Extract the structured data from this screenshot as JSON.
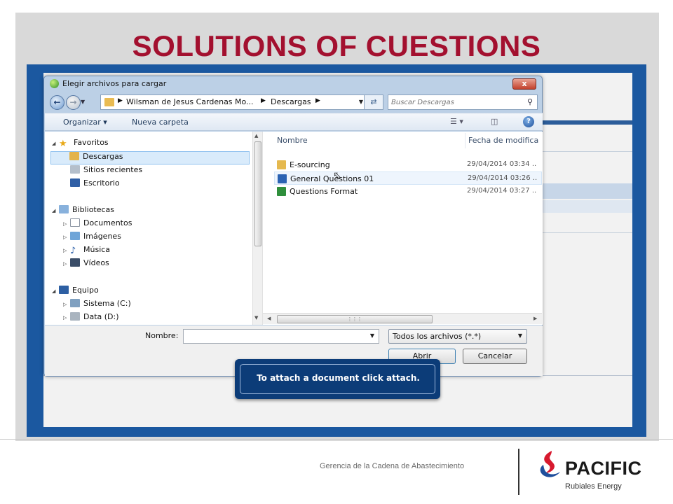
{
  "slide": {
    "title": "SOLUTIONS OF CUESTIONS",
    "title_color": "#a3102f",
    "frame_color": "#1b58a0"
  },
  "dialog": {
    "title": "Elegir archivos para cargar",
    "close_label": "x",
    "back_icon": "back-arrow-icon",
    "forward_icon": "forward-arrow-icon",
    "breadcrumb": [
      "Wilsman de Jesus Cardenas Mo...",
      "Descargas"
    ],
    "search_placeholder": "Buscar Descargas",
    "toolbar": {
      "organize_label": "Organizar ▾",
      "new_folder_label": "Nueva carpeta"
    },
    "nav": {
      "favorites": "Favoritos",
      "downloads": "Descargas",
      "recent": "Sitios recientes",
      "desktop": "Escritorio",
      "libraries": "Bibliotecas",
      "documents": "Documentos",
      "images": "Imágenes",
      "music": "Música",
      "videos": "Vídeos",
      "computer": "Equipo",
      "system": "Sistema (C:)",
      "data": "Data (D:)"
    },
    "columns": {
      "name": "Nombre",
      "date": "Fecha de modifica"
    },
    "files": [
      {
        "name": "E-sourcing",
        "date": "29/04/2014 03:34 ..",
        "type": "folder"
      },
      {
        "name": "General Questions 01",
        "date": "29/04/2014 03:26 ..",
        "type": "word"
      },
      {
        "name": "Questions Format",
        "date": "29/04/2014 03:27 ..",
        "type": "excel"
      }
    ],
    "filename_label": "Nombre:",
    "filename_value": "",
    "filetype_value": "Todos los archivos (*.*)",
    "open_label": "Abrir",
    "cancel_label": "Cancelar"
  },
  "callout": {
    "text": "To attach a document click attach.",
    "bg_color": "#0c3c78"
  },
  "footer": {
    "department": "Gerencia de la Cadena de Abastecimiento",
    "logo_name": "PACIFIC",
    "logo_sub": "Rubiales Energy",
    "logo_colors": [
      "#d7192e",
      "#1f4f9c"
    ]
  }
}
